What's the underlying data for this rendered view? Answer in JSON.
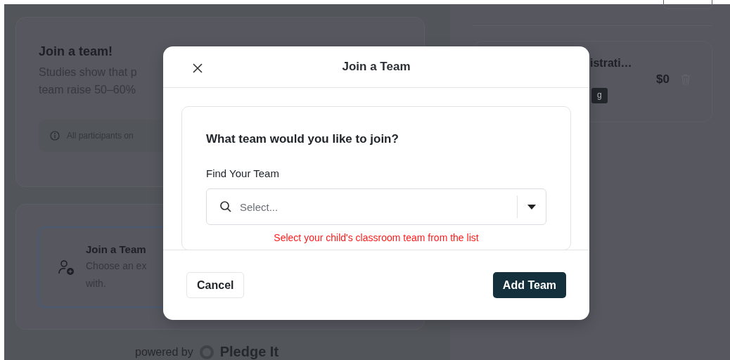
{
  "background": {
    "join_card": {
      "title": "Join a team!",
      "description_lines": [
        "Studies show that p",
        "team raise 50–60%"
      ],
      "notice": "All participants on"
    },
    "option_card": {
      "title": "Join a Team",
      "description_lines": [
        "Choose an ex",
        "with."
      ],
      "selected": true
    },
    "footer": {
      "powered_by": "powered by",
      "logo_text": "Pledge It"
    },
    "cart_item": {
      "name": "istrati…",
      "price": "$0",
      "tag": "g"
    }
  },
  "modal": {
    "title": "Join a Team",
    "question": "What team would you like to join?",
    "field_label": "Find Your Team",
    "select": {
      "placeholder": "Select..."
    },
    "hint": "Select your child's classroom team from the list",
    "buttons": [
      {
        "label": "Cancel",
        "kind": "secondary"
      },
      {
        "label": "Add Team",
        "kind": "primary"
      }
    ]
  }
}
